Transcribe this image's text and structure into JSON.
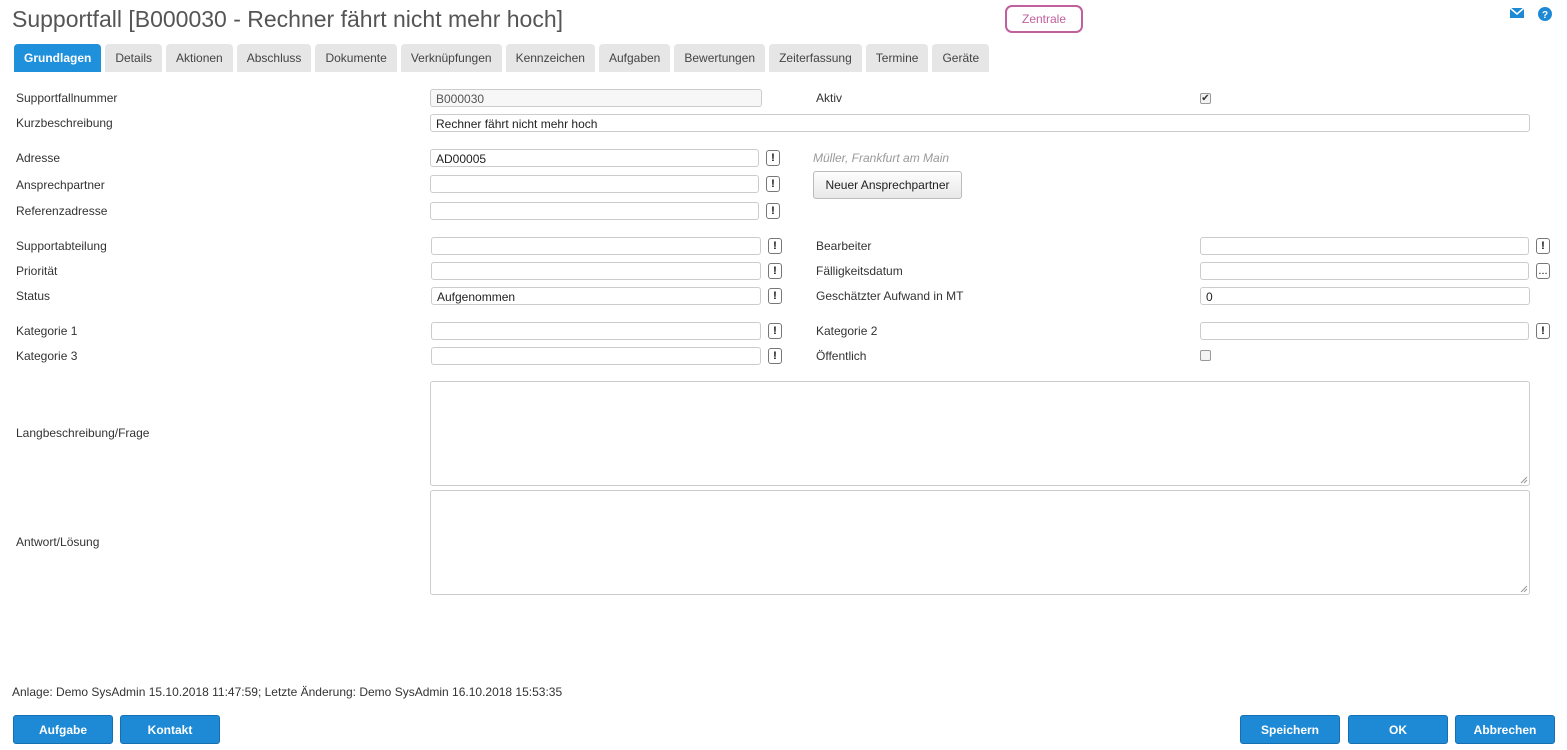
{
  "window": {
    "title": "Supportfall [B000030 - Rechner fährt nicht mehr hoch]",
    "zentrale_label": "Zentrale"
  },
  "icons": {
    "mail": "mail-icon",
    "help": "help-icon"
  },
  "tabs": [
    {
      "label": "Grundlagen",
      "active": true
    },
    {
      "label": "Details"
    },
    {
      "label": "Aktionen"
    },
    {
      "label": "Abschluss"
    },
    {
      "label": "Dokumente"
    },
    {
      "label": "Verknüpfungen"
    },
    {
      "label": "Kennzeichen"
    },
    {
      "label": "Aufgaben"
    },
    {
      "label": "Bewertungen"
    },
    {
      "label": "Zeiterfassung"
    },
    {
      "label": "Termine"
    },
    {
      "label": "Geräte"
    }
  ],
  "form": {
    "supportfallnummer": {
      "label": "Supportfallnummer",
      "value": "B000030"
    },
    "aktiv": {
      "label": "Aktiv",
      "checked": true
    },
    "kurzbeschreibung": {
      "label": "Kurzbeschreibung",
      "value": "Rechner fährt nicht mehr hoch"
    },
    "adresse": {
      "label": "Adresse",
      "value": "AD00005",
      "hint": "Müller, Frankfurt am Main"
    },
    "ansprechpartner": {
      "label": "Ansprechpartner",
      "value": ""
    },
    "neuer_ansprechpartner": "Neuer Ansprechpartner",
    "referenzadresse": {
      "label": "Referenzadresse",
      "value": ""
    },
    "supportabteilung": {
      "label": "Supportabteilung",
      "value": ""
    },
    "bearbeiter": {
      "label": "Bearbeiter",
      "value": ""
    },
    "prioritaet": {
      "label": "Priorität",
      "value": ""
    },
    "faelligkeitsdatum": {
      "label": "Fälligkeitsdatum",
      "value": "",
      "picker": "..."
    },
    "status": {
      "label": "Status",
      "value": "Aufgenommen"
    },
    "aufwand": {
      "label": "Geschätzter Aufwand in MT",
      "value": "0"
    },
    "kategorie1": {
      "label": "Kategorie 1",
      "value": ""
    },
    "kategorie2": {
      "label": "Kategorie 2",
      "value": ""
    },
    "kategorie3": {
      "label": "Kategorie 3",
      "value": ""
    },
    "oeffentlich": {
      "label": "Öffentlich",
      "checked": false
    },
    "langbeschreibung": {
      "label": "Langbeschreibung/Frage",
      "value": ""
    },
    "antwort": {
      "label": "Antwort/Lösung",
      "value": ""
    },
    "lookup_glyph": "!"
  },
  "footer": {
    "info": "Anlage: Demo SysAdmin 15.10.2018 11:47:59; Letzte Änderung: Demo SysAdmin 16.10.2018 15:53:35",
    "buttons": {
      "aufgabe": "Aufgabe",
      "kontakt": "Kontakt",
      "speichern": "Speichern",
      "ok": "OK",
      "abbrechen": "Abbrechen"
    }
  }
}
